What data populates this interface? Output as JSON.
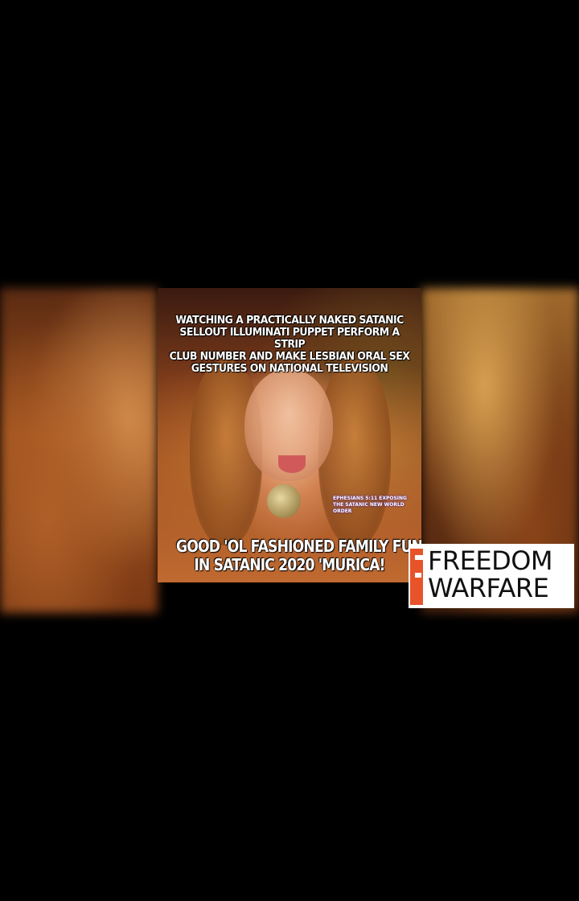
{
  "video": {
    "top_caption": [
      "WATCHING A PRACTICALLY NAKED SATANIC",
      "SELLOUT ILLUMINATI PUPPET PERFORM A STRIP",
      "CLUB NUMBER AND MAKE LESBIAN ORAL SEX",
      "GESTURES ON NATIONAL TELEVISION"
    ],
    "small_caption": [
      "EPHESIANS 5:11    EXPOSING",
      "THE SATANIC NEW WORLD ORDER"
    ],
    "bottom_caption": [
      "GOOD 'OL FASHIONED FAMILY FUN",
      "IN SATANIC 2020 'MURICA!"
    ]
  },
  "watermark": {
    "line1": "FREEDOM",
    "line2": "WARFARE",
    "accent_color": "#e8542a"
  },
  "colors": {
    "background": "#000000"
  }
}
